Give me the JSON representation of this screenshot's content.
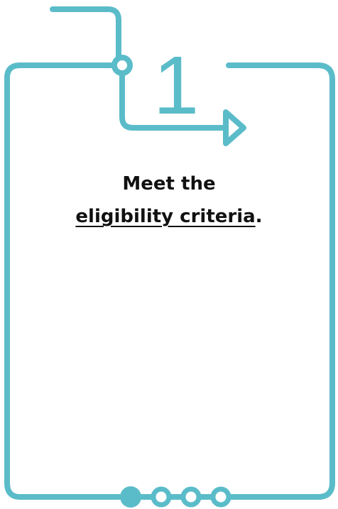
{
  "step": {
    "number": "1",
    "text_before": "Meet the",
    "link_text": "eligibility criteria",
    "text_after": "."
  },
  "progress": {
    "total_steps": 4,
    "current_step": 1
  },
  "colors": {
    "accent": "#5bbcc9",
    "text": "#111111",
    "background": "#ffffff"
  }
}
